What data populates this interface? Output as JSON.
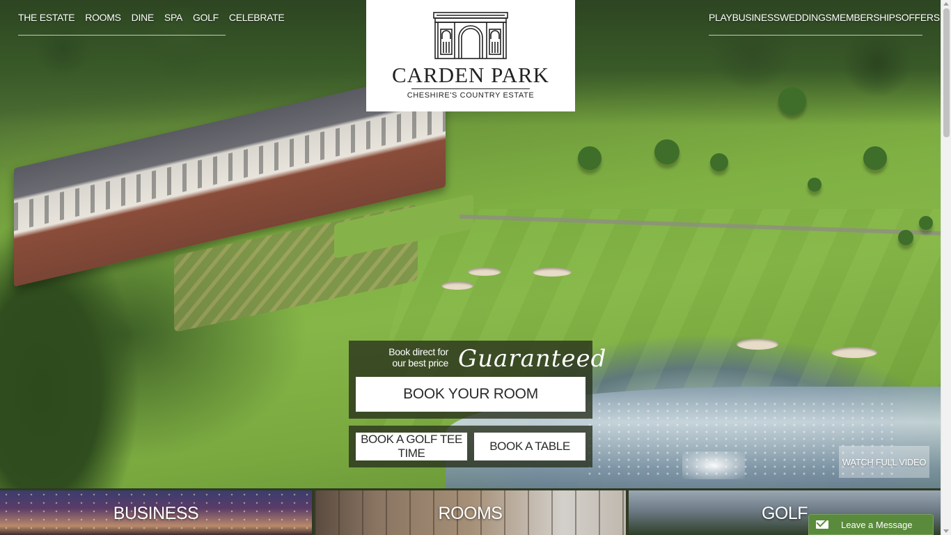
{
  "nav_left": [
    "THE ESTATE",
    "ROOMS",
    "DINE",
    "SPA",
    "GOLF",
    "CELEBRATE"
  ],
  "nav_right": [
    "PLAY",
    "BUSINESS",
    "WEDDINGS",
    "MEMBERSHIPS",
    "OFFERS"
  ],
  "logo": {
    "name": "CARDEN PARK",
    "tagline": "CHESHIRE'S COUNTRY ESTATE",
    "icon": "arch-gate-icon"
  },
  "booking": {
    "book_direct_line1": "Book direct for",
    "book_direct_line2": "our best price",
    "guaranteed": "Guaranteed",
    "book_room": "BOOK YOUR ROOM",
    "book_golf": "BOOK A GOLF TEE TIME",
    "book_table": "BOOK A TABLE"
  },
  "watch_video": "WATCH FULL VIDEO",
  "tiles": [
    "BUSINESS",
    "ROOMS",
    "GOLF"
  ],
  "chat": {
    "label": "Leave a Message",
    "icon": "envelope-icon"
  },
  "colors": {
    "panel_bg": "rgba(40,48,28,0.78)",
    "chat_green": "#5a8a3b"
  }
}
